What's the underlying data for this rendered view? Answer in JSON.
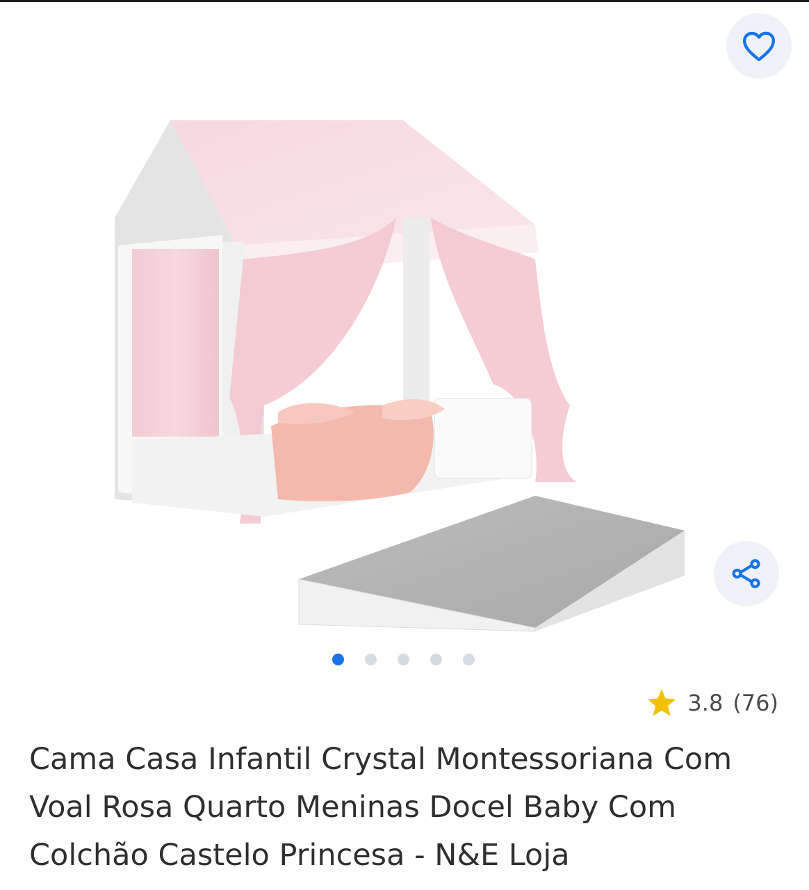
{
  "product": {
    "title": "Cama Casa Infantil Crystal Montessoriana Com Voal Rosa Quarto Meninas Docel Baby Com Colchão Castelo Princesa - N&E Loja",
    "rating": "3.8",
    "review_count": "(76)"
  },
  "gallery": {
    "total_images": 5,
    "active_index": 0
  },
  "icons": {
    "favorite": "heart-outline-icon",
    "share": "share-icon",
    "rating": "star-icon"
  },
  "colors": {
    "accent": "#1a73e8",
    "star": "#f2c200",
    "fab_background": "#eef1f5",
    "dot_inactive": "#d6dbe2",
    "text": "#2f2f2f"
  }
}
